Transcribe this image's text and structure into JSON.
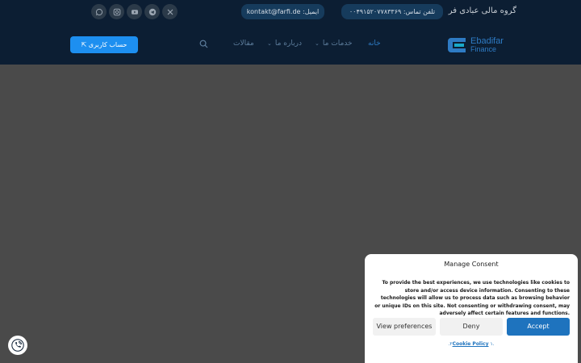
{
  "topbar": {
    "brand": "گروه مالی عبادی فر",
    "phone": "تلفن تماس: ۰۰۴۹۱۵۲۰۷۷۸۳۳۶۹",
    "email": "kontakt@farfi.de :ایمیل",
    "socials": [
      "whatsapp-icon",
      "instagram-icon",
      "youtube-icon",
      "telegram-icon",
      "x-icon"
    ]
  },
  "header": {
    "logo_line1": "Ebadifar",
    "logo_line2": "Finance",
    "nav": {
      "home": "خانه",
      "services": "خدمات ما",
      "about": "درباره ما",
      "articles": "مقالات"
    },
    "account_button": "حساب کاربری ⇱"
  },
  "consent": {
    "title": "Manage Consent",
    "body": "To provide the best experiences, we use technologies like cookies to store and/or access device information. Consenting to these technologies will allow us to process data such as browsing behavior or unique IDs on this site. Not consenting or withdrawing consent, may adversely affect certain features and functions.",
    "view_preferences": "View preferences",
    "deny": "Deny",
    "accept": "Accept",
    "cookie_policy": "Cookie Policy",
    "link_prefix": "۱.",
    "link_suffix": ".۲"
  },
  "colors": {
    "topbar_bg": "#0c1e33",
    "overlay": "#4a4a4a",
    "accent": "#1d8ff0",
    "accept": "#1e73be"
  }
}
